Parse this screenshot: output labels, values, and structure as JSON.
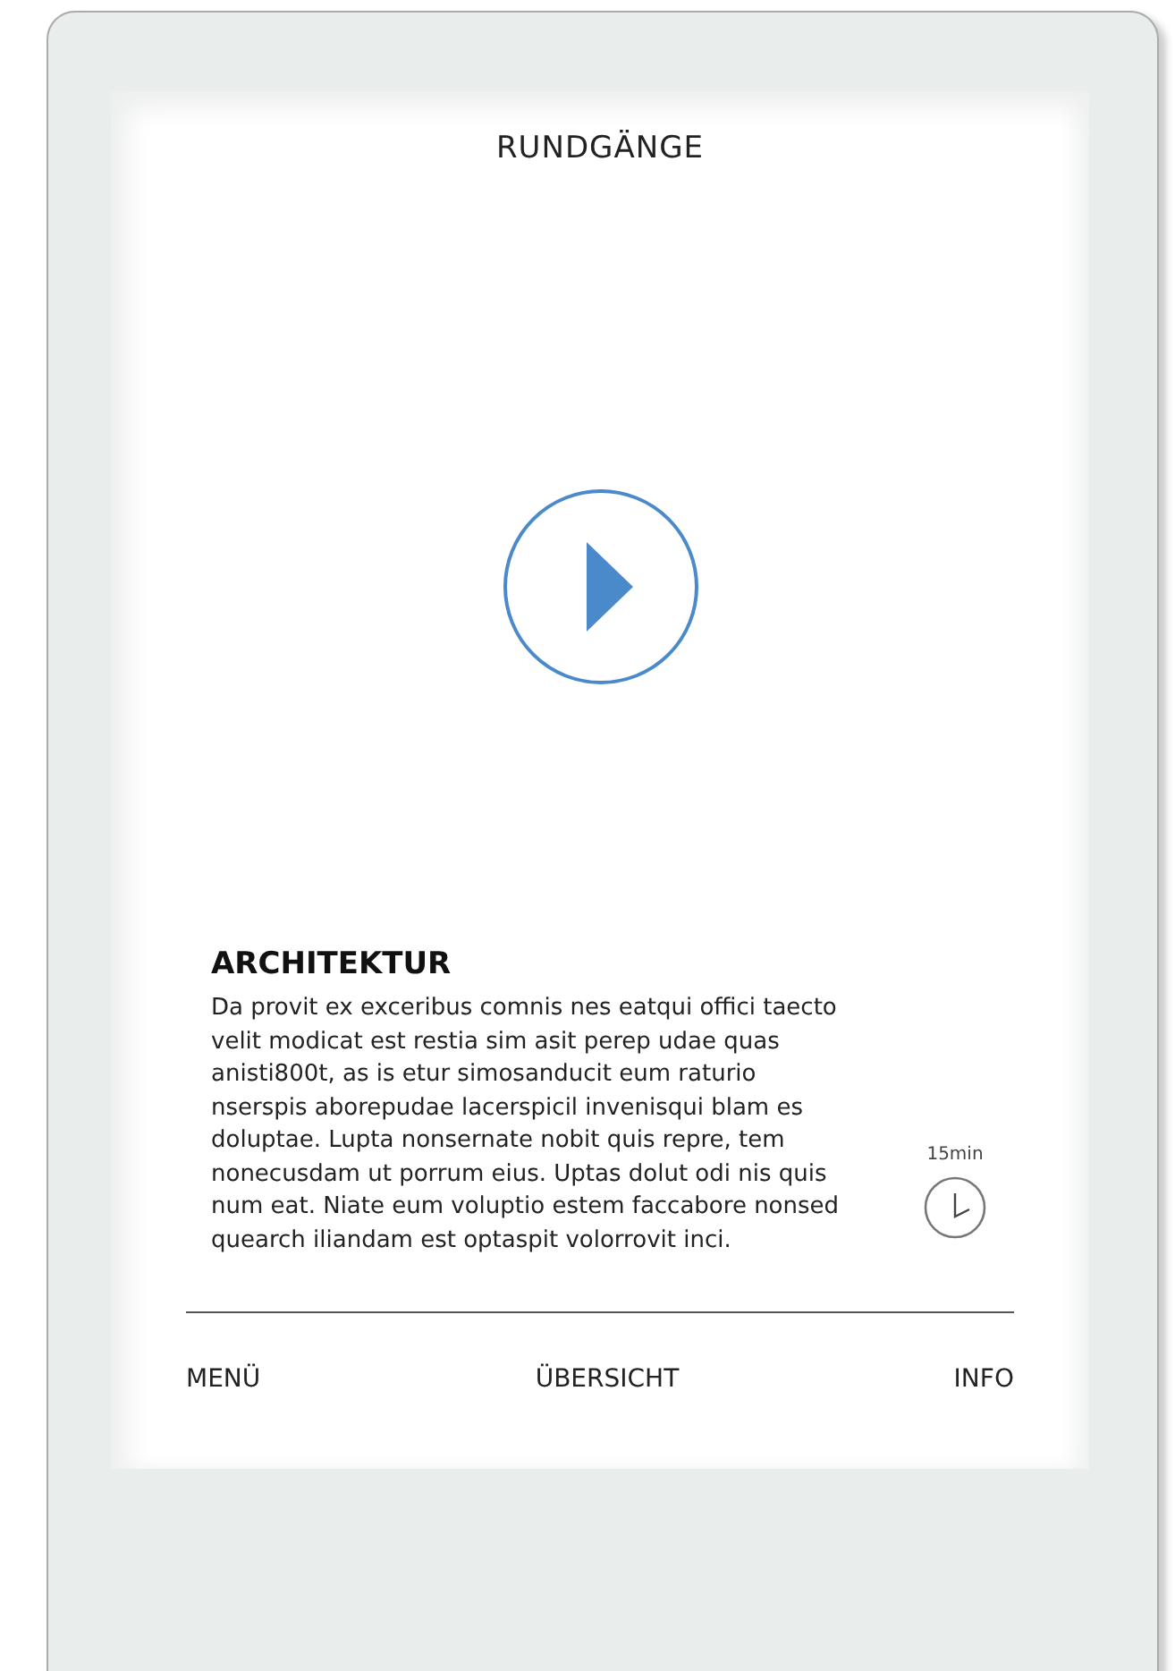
{
  "screen": {
    "title": "RUNDGÄNGE"
  },
  "tour": {
    "heading": "ARCHITEKTUR",
    "text": "Da provit ex exceribus comnis nes eatqui offici taecto velit modicat est restia sim asit perep udae quas anisti800t, as is etur simosanducit eum raturio nserspis aborepudae lacerspicil invenisqui blam es doluptae. Lupta nonsernate nobit quis repre, tem nonecusdam ut porrum eius. Uptas dolut odi nis quis num eat. Niate eum voluptio estem faccabore nonsed quearch iliandam est optaspit volorrovit inci.",
    "duration": "15min"
  },
  "nav": [
    {
      "label": "MENÜ"
    },
    {
      "label": "ÜBERSICHT"
    },
    {
      "label": "INFO"
    }
  ]
}
